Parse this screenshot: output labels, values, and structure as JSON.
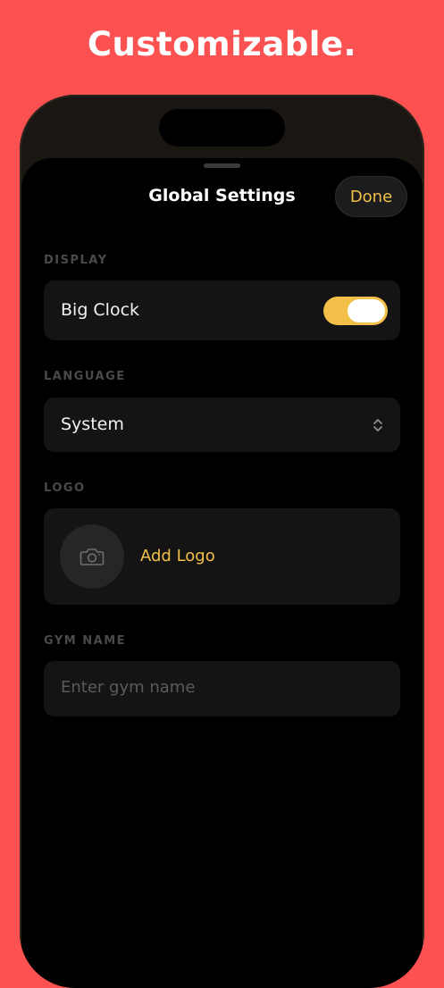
{
  "headline": "Customizable.",
  "sheet": {
    "title": "Global Settings",
    "done_label": "Done"
  },
  "display": {
    "section_label": "DISPLAY",
    "big_clock_label": "Big Clock",
    "big_clock_on": true
  },
  "language": {
    "section_label": "LANGUAGE",
    "selected": "System"
  },
  "logo": {
    "section_label": "LOGO",
    "add_label": "Add Logo"
  },
  "gym_name": {
    "section_label": "GYM NAME",
    "placeholder": "Enter gym name",
    "value": ""
  },
  "colors": {
    "background": "#fc5151",
    "accent": "#f2c048",
    "card": "#141414"
  },
  "icons": {
    "language_chevron": "chevron-up-down-icon",
    "logo_placeholder": "camera-icon"
  }
}
